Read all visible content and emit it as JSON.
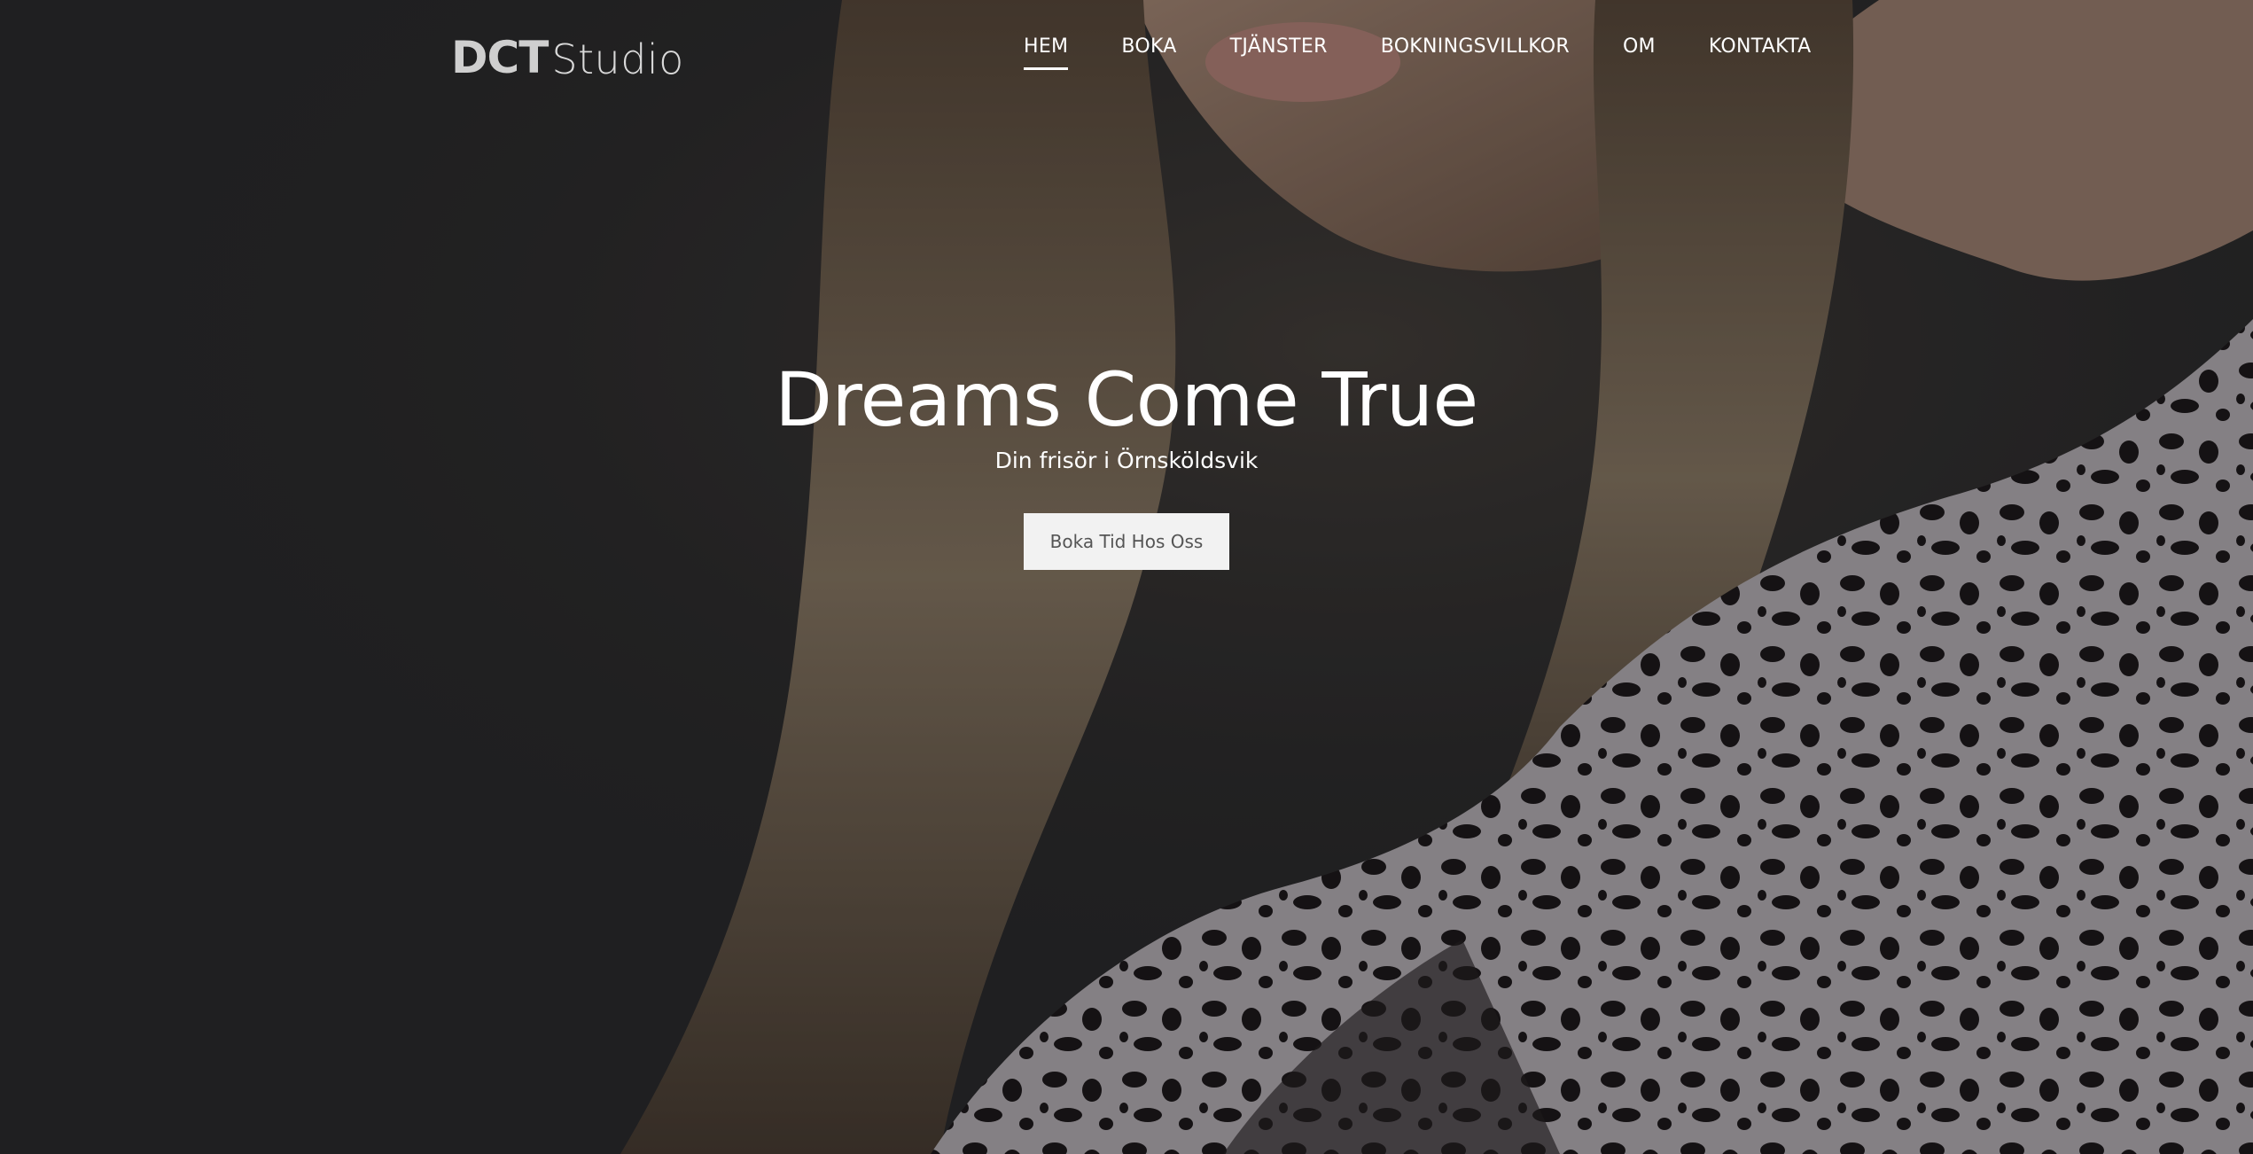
{
  "brand": {
    "mark": "DCT",
    "word": "Studio"
  },
  "nav": {
    "items": [
      {
        "label": "HEM",
        "active": true
      },
      {
        "label": "BOKA",
        "active": false
      },
      {
        "label": "TJÄNSTER",
        "active": false
      },
      {
        "label": "BOKNINGSVILLKOR",
        "active": false
      },
      {
        "label": "OM",
        "active": false
      },
      {
        "label": "KONTAKTA",
        "active": false
      }
    ]
  },
  "hero": {
    "title": "Dreams Come True",
    "subtitle": "Din frisör i Örnsköldsvik",
    "cta_label": "Boka Tid Hos Oss"
  },
  "colors": {
    "text": "#ffffff",
    "button_bg": "#f2f2f2",
    "button_text": "#555555"
  }
}
